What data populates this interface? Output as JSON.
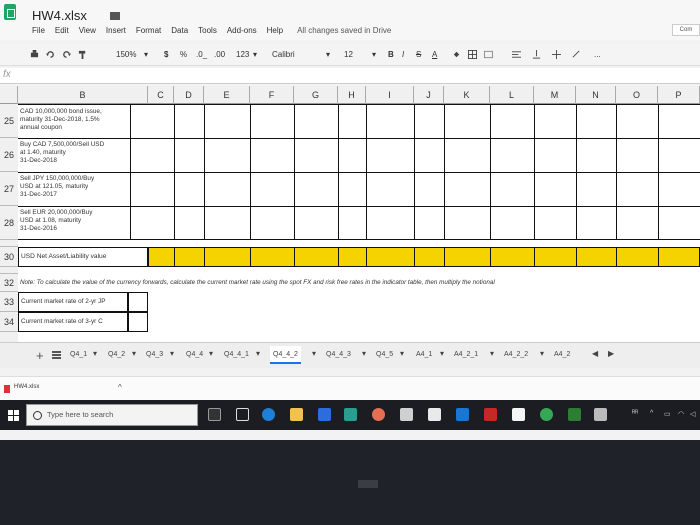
{
  "document": {
    "title": "HW4.xlsx"
  },
  "menu": {
    "items": [
      "File",
      "Edit",
      "View",
      "Insert",
      "Format",
      "Data",
      "Tools",
      "Add-ons",
      "Help"
    ],
    "save_status": "All changes saved in Drive"
  },
  "header": {
    "comments_label": "Com"
  },
  "toolbar": {
    "zoom": "150%",
    "currency": "$",
    "percent": "%",
    "decimal_decrease": ".0_",
    "decimal_increase": ".00",
    "more_formats": "123",
    "font": "Calibri",
    "font_size": "12",
    "bold": "B",
    "italic": "I",
    "strikethrough": "S",
    "text_color": "A",
    "more": "..."
  },
  "formula_bar": {
    "fx_label": "fx"
  },
  "columns": [
    "B",
    "C",
    "D",
    "E",
    "F",
    "G",
    "H",
    "I",
    "J",
    "K",
    "L",
    "M",
    "N",
    "O",
    "P"
  ],
  "rows": {
    "r25": {
      "num": "25",
      "text": [
        "CAD 10,000,000 bond issue,",
        "maturity 31-Dec-2018, 1.5%",
        "annual coupon"
      ]
    },
    "r26": {
      "num": "26",
      "text": [
        "Buy CAD 7,500,000/Sell USD",
        "at 1.40, maturity",
        "31-Dec-2018"
      ]
    },
    "r27": {
      "num": "27",
      "text": [
        "Sell JPY 150,000,000/Buy",
        "USD at 121.05, maturity",
        "31-Dec-2017"
      ]
    },
    "r28": {
      "num": "28",
      "text": [
        "Sell EUR 20,000,000/Buy",
        "USD at 1.08, maturity",
        "31-Dec-2016"
      ]
    },
    "r29": {
      "num": ""
    },
    "r30": {
      "num": "30",
      "text": "USD Net Asset/Liability value"
    },
    "r31": {
      "num": ""
    },
    "r32": {
      "num": "32",
      "text": "Note: To calculate the value of the currency forwards, calculate the current market rate using the spot FX and risk free rates in the indicator table, then multiply the notional"
    },
    "r33": {
      "num": "33",
      "text": "Current market rate of 2-yr JP"
    },
    "r34": {
      "num": "34",
      "text": "Current market rate of 3-yr C"
    }
  },
  "sheet_tabs": {
    "add": "+",
    "items": [
      "Q4_1",
      "Q4_2",
      "Q4_3",
      "Q4_4",
      "Q4_4_1",
      "Q4_4_2",
      "Q4_4_3",
      "Q4_5",
      "A4_1",
      "A4_2_1",
      "A4_2_2",
      "A4_2"
    ],
    "active": "Q4_4_2"
  },
  "downloads": {
    "file": "HW4.xlsx",
    "caret": "^"
  },
  "taskbar": {
    "search_placeholder": "Type here to search"
  },
  "colors": {
    "highlight_yellow": "#f5d300",
    "sheets_green": "#1fa463",
    "active_tab_blue": "#1a73e8"
  }
}
